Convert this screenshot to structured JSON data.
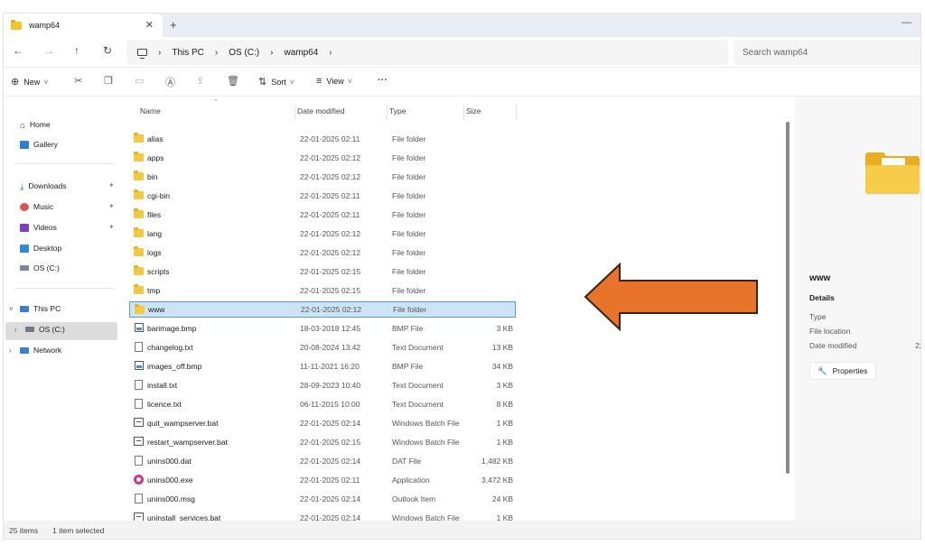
{
  "tab": {
    "title": "wamp64",
    "close": "✕",
    "new": "+"
  },
  "address": {
    "crumbs": [
      "This PC",
      "OS (C:)",
      "wamp64"
    ],
    "search_placeholder": "Search wamp64"
  },
  "toolbar": {
    "new_label": "New",
    "sort_label": "Sort",
    "view_label": "View",
    "more": "···"
  },
  "sidebar": {
    "items": [
      {
        "label": "Home"
      },
      {
        "label": "Gallery"
      },
      {
        "label": "Downloads"
      },
      {
        "label": "Music"
      },
      {
        "label": "Videos"
      },
      {
        "label": "Desktop"
      },
      {
        "label": "OS (C:)"
      },
      {
        "label": "This PC"
      },
      {
        "label": "OS (C:)"
      },
      {
        "label": "Network"
      }
    ]
  },
  "columns": {
    "name": "Name",
    "date": "Date modified",
    "type": "Type",
    "size": "Size"
  },
  "files": [
    {
      "name": "alias",
      "date": "22-01-2025 02:11",
      "type": "File folder",
      "size": "",
      "icon": "folder"
    },
    {
      "name": "apps",
      "date": "22-01-2025 02:12",
      "type": "File folder",
      "size": "",
      "icon": "folder"
    },
    {
      "name": "bin",
      "date": "22-01-2025 02:12",
      "type": "File folder",
      "size": "",
      "icon": "folder"
    },
    {
      "name": "cgi-bin",
      "date": "22-01-2025 02:11",
      "type": "File folder",
      "size": "",
      "icon": "folder"
    },
    {
      "name": "files",
      "date": "22-01-2025 02:11",
      "type": "File folder",
      "size": "",
      "icon": "folder"
    },
    {
      "name": "lang",
      "date": "22-01-2025 02:12",
      "type": "File folder",
      "size": "",
      "icon": "folder"
    },
    {
      "name": "logs",
      "date": "22-01-2025 02:12",
      "type": "File folder",
      "size": "",
      "icon": "folder"
    },
    {
      "name": "scripts",
      "date": "22-01-2025 02:15",
      "type": "File folder",
      "size": "",
      "icon": "folder"
    },
    {
      "name": "tmp",
      "date": "22-01-2025 02:15",
      "type": "File folder",
      "size": "",
      "icon": "folder"
    },
    {
      "name": "www",
      "date": "22-01-2025 02:12",
      "type": "File folder",
      "size": "",
      "icon": "folder",
      "selected": true
    },
    {
      "name": "barimage.bmp",
      "date": "18-03-2018 12:45",
      "type": "BMP File",
      "size": "3 KB",
      "icon": "img"
    },
    {
      "name": "changelog.txt",
      "date": "20-08-2024 13:42",
      "type": "Text Document",
      "size": "13 KB",
      "icon": "doc"
    },
    {
      "name": "images_off.bmp",
      "date": "11-11-2021 16:20",
      "type": "BMP File",
      "size": "34 KB",
      "icon": "img"
    },
    {
      "name": "install.txt",
      "date": "28-09-2023 10:40",
      "type": "Text Document",
      "size": "3 KB",
      "icon": "doc"
    },
    {
      "name": "licence.txt",
      "date": "06-11-2015 10:00",
      "type": "Text Document",
      "size": "8 KB",
      "icon": "doc"
    },
    {
      "name": "quit_wampserver.bat",
      "date": "22-01-2025 02:14",
      "type": "Windows Batch File",
      "size": "1 KB",
      "icon": "bat"
    },
    {
      "name": "restart_wampserver.bat",
      "date": "22-01-2025 02:15",
      "type": "Windows Batch File",
      "size": "1 KB",
      "icon": "bat"
    },
    {
      "name": "unins000.dat",
      "date": "22-01-2025 02:14",
      "type": "DAT File",
      "size": "1,482 KB",
      "icon": "doc"
    },
    {
      "name": "unins000.exe",
      "date": "22-01-2025 02:11",
      "type": "Application",
      "size": "3,472 KB",
      "icon": "exe"
    },
    {
      "name": "unins000.msg",
      "date": "22-01-2025 02:14",
      "type": "Outlook Item",
      "size": "24 KB",
      "icon": "doc"
    },
    {
      "name": "uninstall_services.bat",
      "date": "22-01-2025 02:14",
      "type": "Windows Batch File",
      "size": "1 KB",
      "icon": "bat"
    }
  ],
  "details": {
    "title": "www",
    "heading": "Details",
    "type_label": "Type",
    "location_label": "File location",
    "modified_label": "Date modified",
    "modified_value": "22",
    "properties_label": "Properties"
  },
  "status": {
    "count": "25 items",
    "selected": "1 item selected"
  },
  "colors": {
    "selection": "#cde4f7",
    "selection_border": "#5b9ad5",
    "arrow": "#e8732a",
    "folder": "#f5c842"
  }
}
